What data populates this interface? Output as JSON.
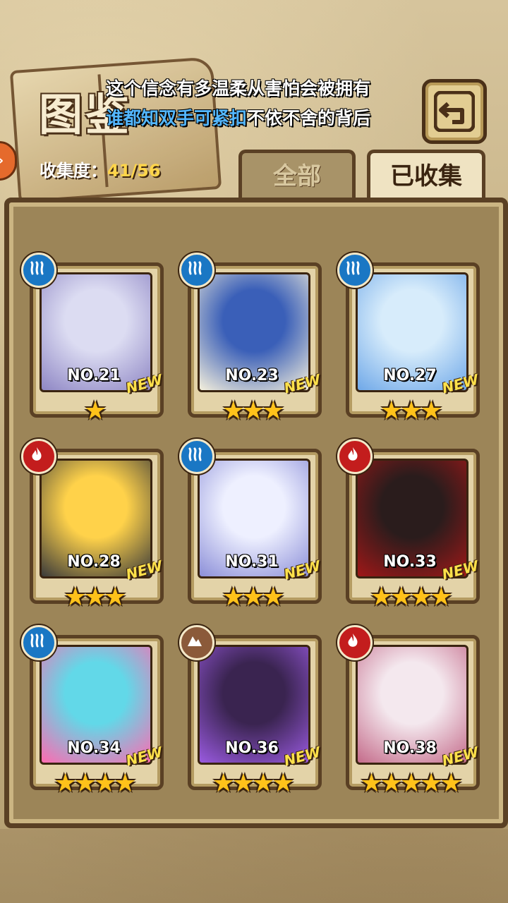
{
  "header": {
    "title": "图鉴",
    "progress_label": "收集度：",
    "progress_value": "41/56",
    "lyric_line1": "这个信念有多温柔从害怕会被拥有",
    "lyric_line2_highlight": "谁都知双手可紧扣",
    "lyric_line2_rest": "不依不舍的背后"
  },
  "tabs": [
    {
      "label": "全部",
      "selected": false
    },
    {
      "label": "已收集",
      "selected": true
    }
  ],
  "cards": [
    {
      "number": "NO.21",
      "stars": "★",
      "element": "water",
      "badge": "NEW",
      "colors": [
        "#dcdcf2",
        "#8e86c4"
      ]
    },
    {
      "number": "NO.23",
      "stars": "★★★",
      "element": "water",
      "badge": "NEW",
      "colors": [
        "#3a5fb8",
        "#f5f0dc"
      ]
    },
    {
      "number": "NO.27",
      "stars": "★★★",
      "element": "water",
      "badge": "NEW",
      "colors": [
        "#d7ecfb",
        "#6fa8e8"
      ]
    },
    {
      "number": "NO.28",
      "stars": "★★★",
      "element": "fire",
      "badge": "NEW",
      "colors": [
        "#ffd24a",
        "#3a3a3a"
      ]
    },
    {
      "number": "NO.31",
      "stars": "★★★",
      "element": "water",
      "badge": "NEW",
      "colors": [
        "#eef0ff",
        "#8c8fd8"
      ]
    },
    {
      "number": "NO.33",
      "stars": "★★★★",
      "element": "fire",
      "badge": "NEW",
      "colors": [
        "#2a1c1c",
        "#a01818"
      ]
    },
    {
      "number": "NO.34",
      "stars": "★★★★",
      "element": "water",
      "badge": "NEW",
      "colors": [
        "#62d8e8",
        "#ff6ab0"
      ]
    },
    {
      "number": "NO.36",
      "stars": "★★★★",
      "element": "earth",
      "badge": "NEW",
      "colors": [
        "#3a2450",
        "#9a5ae0"
      ]
    },
    {
      "number": "NO.38",
      "stars": "★★★★★",
      "element": "fire",
      "badge": "NEW",
      "colors": [
        "#f4e8ee",
        "#c46b8a"
      ]
    }
  ]
}
